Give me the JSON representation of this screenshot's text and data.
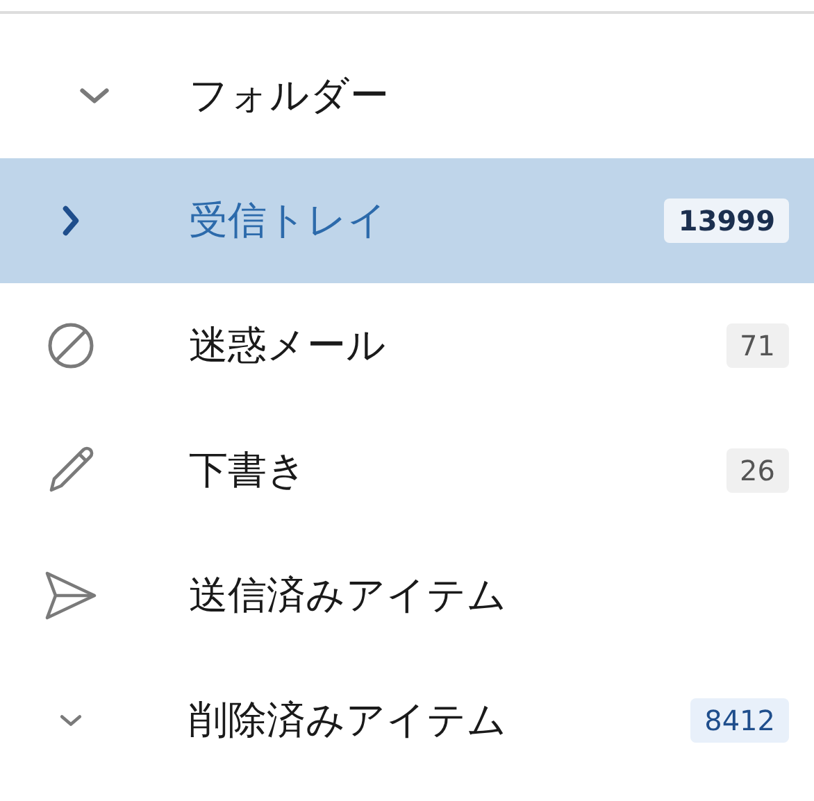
{
  "header": {
    "label": "フォルダー",
    "expanded": true
  },
  "folders": [
    {
      "name": "受信トレイ",
      "kind": "chevron",
      "expanded": false,
      "selected": true,
      "count": "13999",
      "unread": true
    },
    {
      "name": "迷惑メール",
      "kind": "block",
      "selected": false,
      "count": "71",
      "unread": false
    },
    {
      "name": "下書き",
      "kind": "pencil",
      "selected": false,
      "count": "26",
      "unread": false
    },
    {
      "name": "送信済みアイテム",
      "kind": "send",
      "selected": false
    },
    {
      "name": "削除済みアイテム",
      "kind": "chevron",
      "expanded": true,
      "selected": false,
      "count": "8412",
      "unread": true
    }
  ]
}
